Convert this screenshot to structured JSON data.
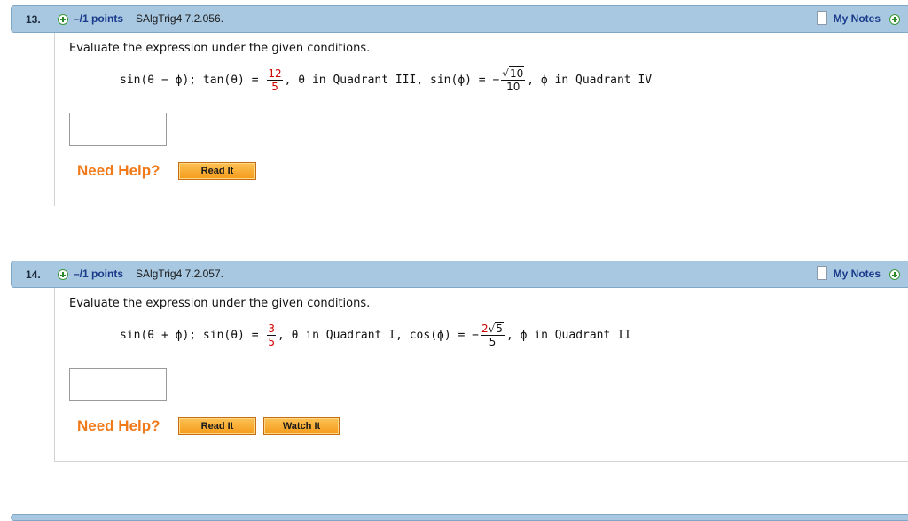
{
  "questions": [
    {
      "number": "13.",
      "points": "–/1 points",
      "source": "SAlgTrig4 7.2.056.",
      "my_notes": "My Notes",
      "prompt": "Evaluate the expression under the given conditions.",
      "expr_part1": "sin(θ − ϕ);  tan(θ) = ",
      "frac1_num": "12",
      "frac1_den": "5",
      "expr_part2": ", θ in Quadrant III,  sin(ϕ) = −",
      "frac2_num_sqrt": "10",
      "frac2_den": "10",
      "expr_part3": ", ϕ in Quadrant IV",
      "need_help": "Need Help?",
      "read_it": "Read It"
    },
    {
      "number": "14.",
      "points": "–/1 points",
      "source": "SAlgTrig4 7.2.057.",
      "my_notes": "My Notes",
      "prompt": "Evaluate the expression under the given conditions.",
      "expr_part1": "sin(θ + ϕ);  sin(θ) = ",
      "frac1_num": "3",
      "frac1_den": "5",
      "expr_part2": ", θ in Quadrant I,  cos(ϕ) = −",
      "frac2_num_coef": "2",
      "frac2_num_sqrt": "5",
      "frac2_den": "5",
      "expr_part3": ", ϕ in Quadrant II",
      "need_help": "Need Help?",
      "read_it": "Read It",
      "watch_it": "Watch It"
    }
  ],
  "colors": {
    "header_bg": "#a8c8e2",
    "points_text": "#1a3a8a",
    "need_help": "#f07a1a",
    "button": "#f5a623",
    "fraction_highlight": "#d00000"
  }
}
